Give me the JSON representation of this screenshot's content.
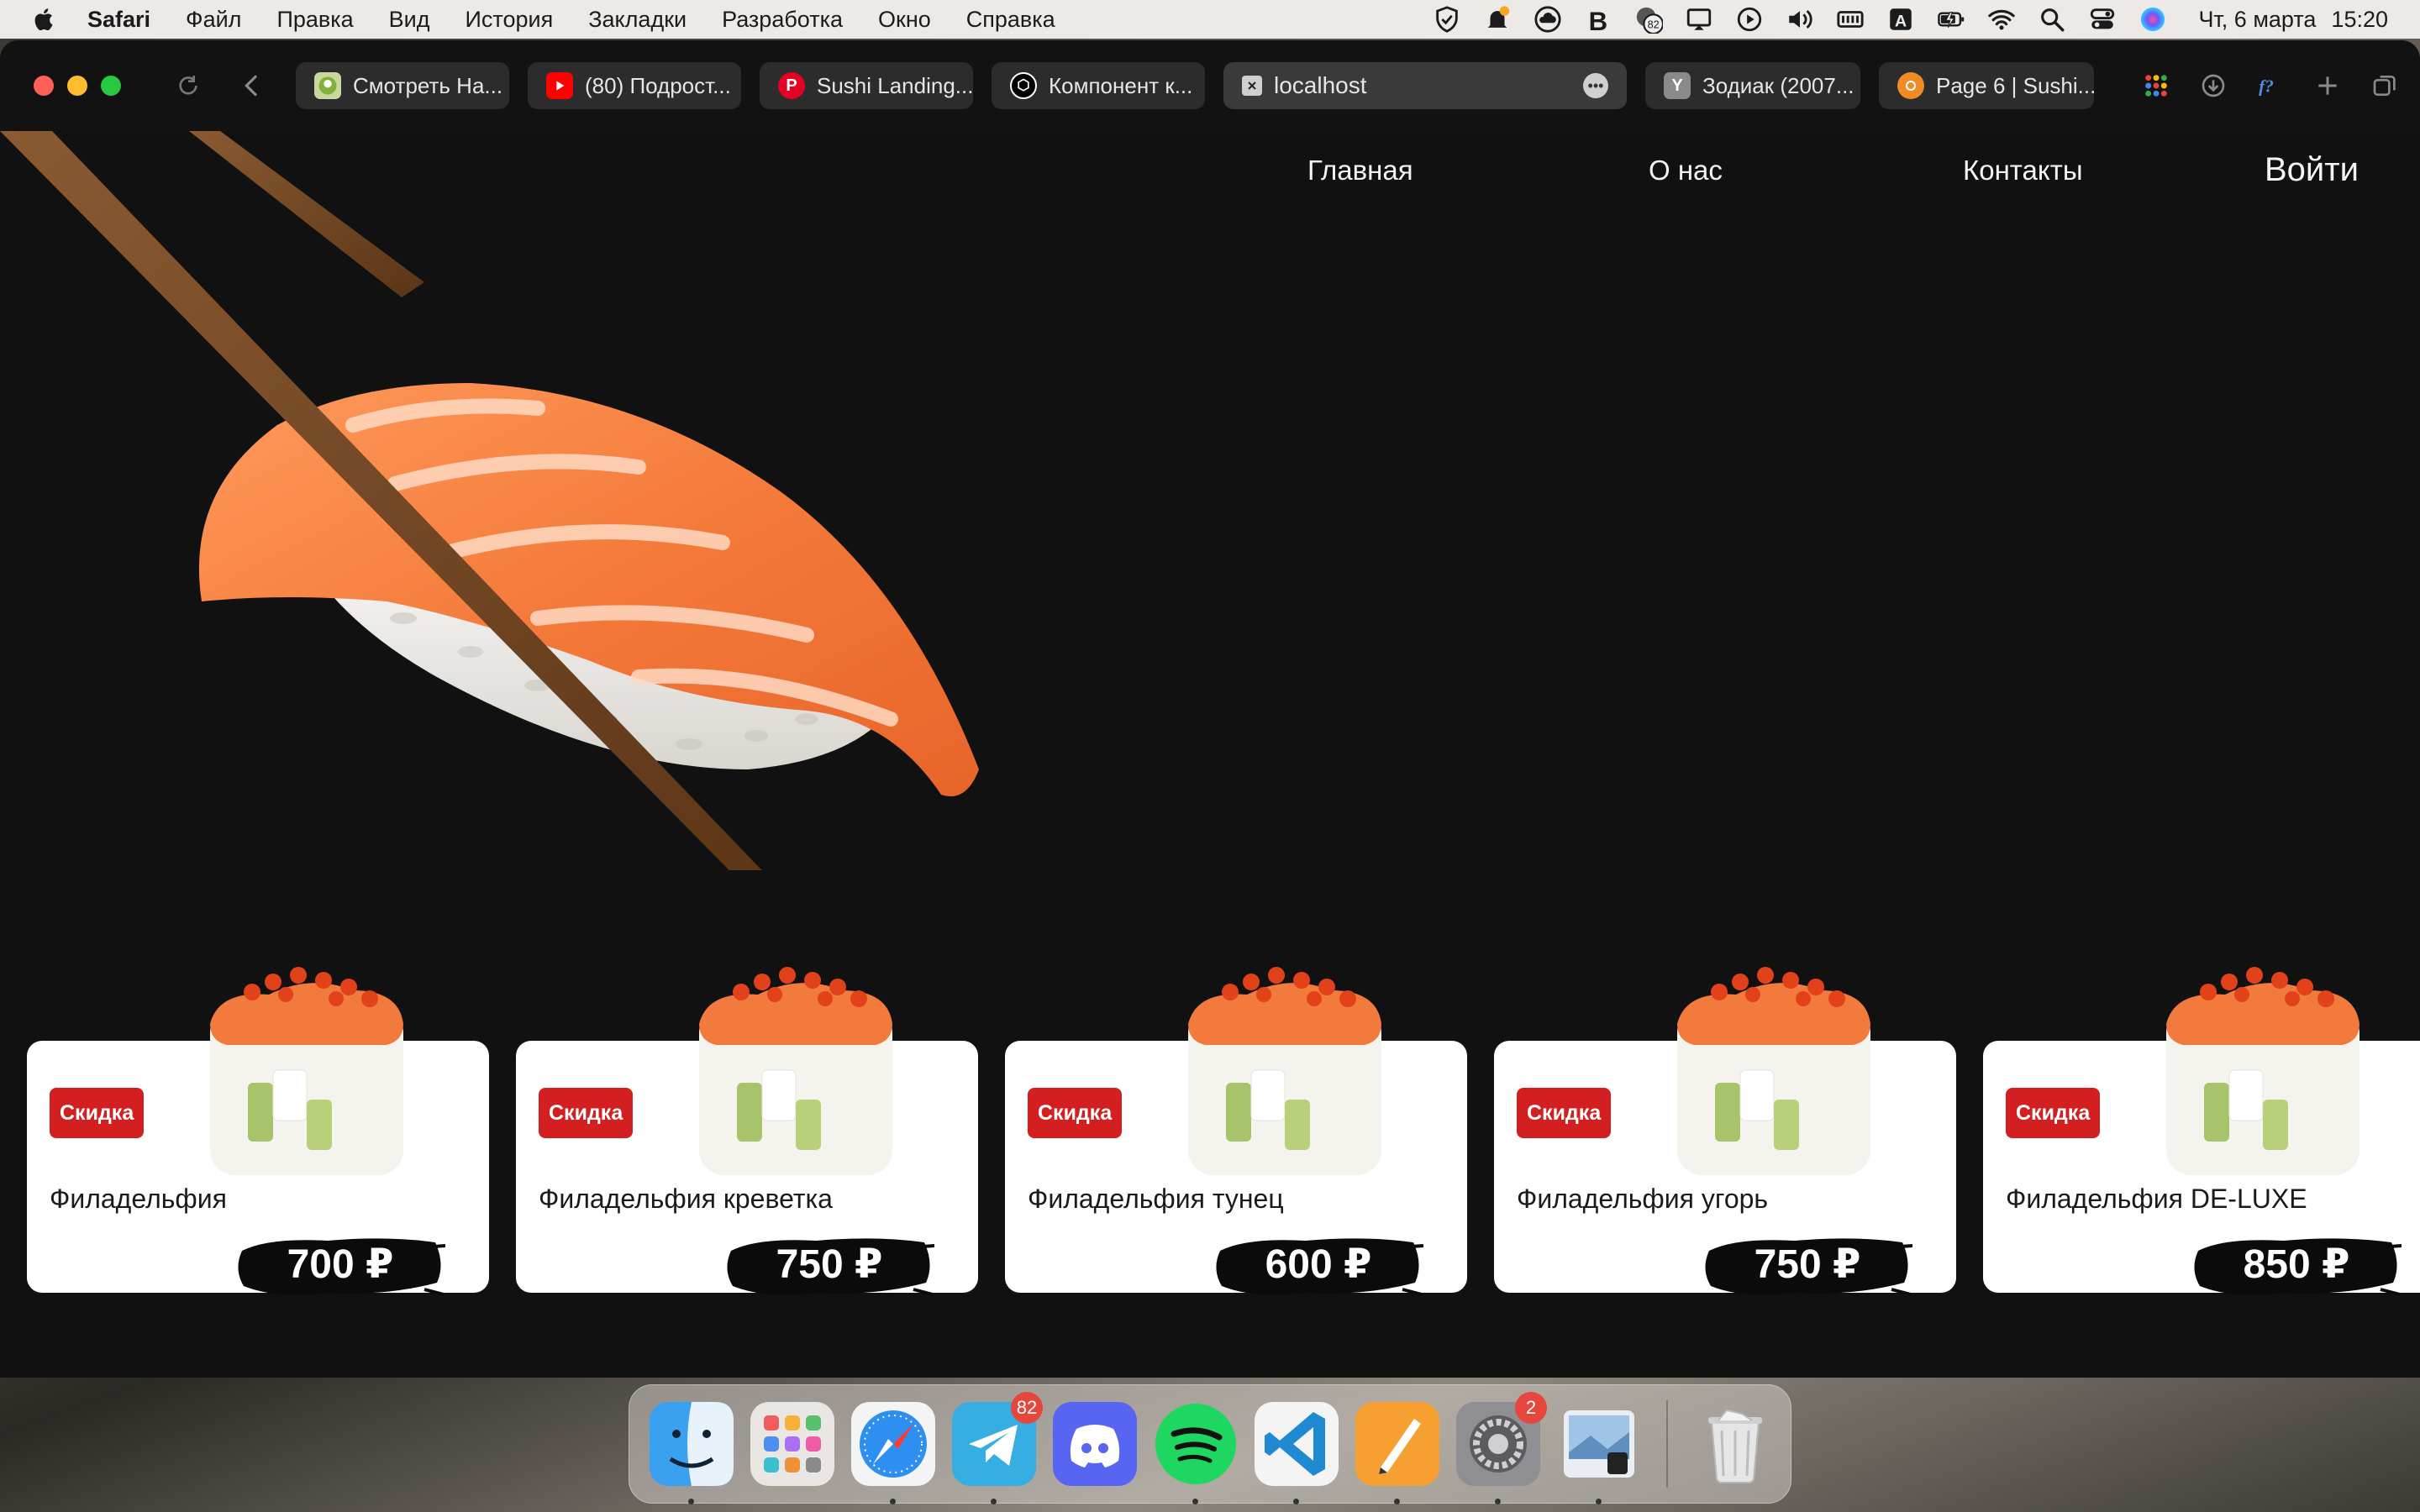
{
  "menubar": {
    "app": "Safari",
    "items": [
      "Файл",
      "Правка",
      "Вид",
      "История",
      "Закладки",
      "Разработка",
      "Окно",
      "Справка"
    ],
    "battery_badge": "82",
    "keyboard_layout": "A",
    "date": "Чт, 6 марта",
    "time": "15:20"
  },
  "browser": {
    "tabs": [
      {
        "label": "Смотреть На...",
        "favicon": "green-logo-icon",
        "color": "#7fb23a"
      },
      {
        "label": "(80) Подрост...",
        "favicon": "youtube-icon",
        "color": "#ff0000"
      },
      {
        "label": "Sushi Landing...",
        "favicon": "pinterest-icon",
        "color": "#e60023"
      },
      {
        "label": "Компонент к...",
        "favicon": "openai-icon",
        "color": "#ffffff"
      }
    ],
    "active_tab": {
      "label": "localhost",
      "favicon": "close-box-icon"
    },
    "tabs_after": [
      {
        "label": "Зодиак (2007...",
        "favicon": "yandex-icon",
        "letter": "Y",
        "color": "#8a8a8a"
      },
      {
        "label": "Page 6 | Sushi...",
        "favicon": "figma-icon",
        "color": "#f08a24"
      }
    ]
  },
  "page": {
    "nav": {
      "home": "Главная",
      "about": "О нас",
      "contacts": "Контакты",
      "login": "Войти"
    },
    "cards": [
      {
        "badge": "Скидка",
        "title": "Филадельфия",
        "price": "700 ₽"
      },
      {
        "badge": "Скидка",
        "title": "Филадельфия креветка",
        "price": "750 ₽"
      },
      {
        "badge": "Скидка",
        "title": "Филадельфия тунец",
        "price": "600 ₽"
      },
      {
        "badge": "Скидка",
        "title": "Филадельфия угорь",
        "price": "750 ₽"
      },
      {
        "badge": "Скидка",
        "title": "Филадельфия DE-LUXE",
        "price": "850 ₽"
      }
    ]
  },
  "dock": {
    "apps": [
      "Finder",
      "Launchpad",
      "Safari",
      "Telegram",
      "Discord",
      "Spotify",
      "Visual Studio Code",
      "Pages",
      "System Settings",
      "Preview",
      "Trash"
    ],
    "telegram_badge": "82",
    "settings_badge": "2"
  }
}
